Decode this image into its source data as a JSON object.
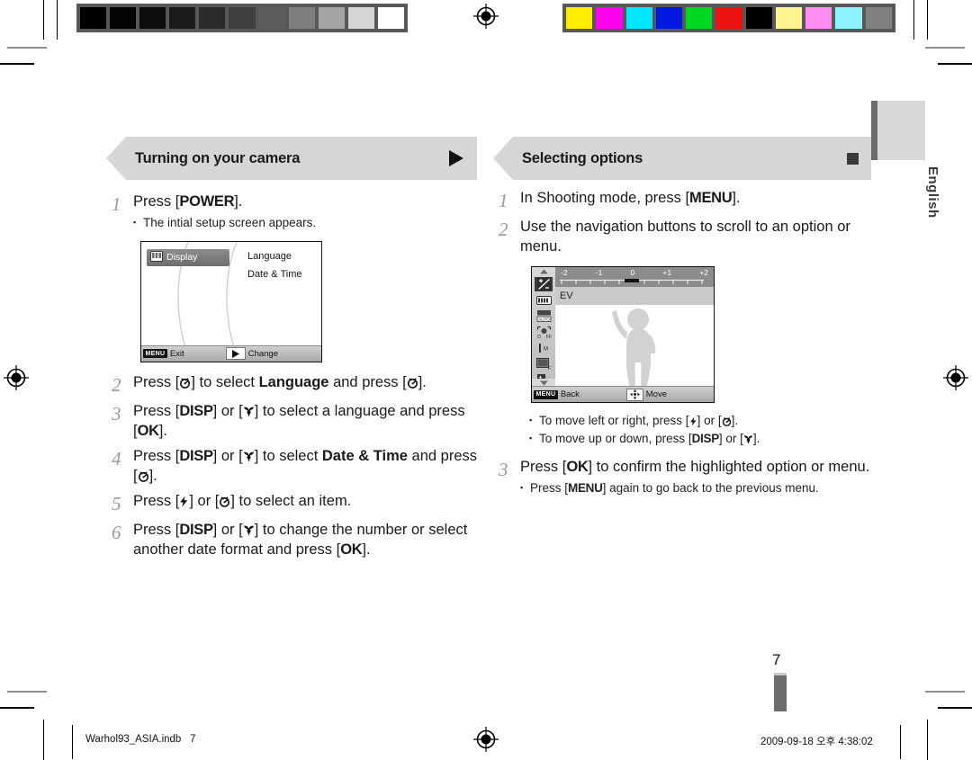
{
  "document": {
    "language_tab": "English",
    "page_number": "7",
    "footer": {
      "file_name": "Warhol93_ASIA.indb",
      "file_page": "7",
      "timestamp": "2009-09-18   오후 4:38:02"
    }
  },
  "calibration": {
    "grayscale_swatches": [
      "#000000",
      "#050505",
      "#0d0d0d",
      "#1b1b1b",
      "#2b2b2b",
      "#3f3f3f",
      "#5c5c5c",
      "#7d7d7d",
      "#a5a5a5",
      "#d5d5d5",
      "#ffffff"
    ],
    "color_swatches": [
      "#ffee00",
      "#ff00ee",
      "#00e8ff",
      "#0018e0",
      "#00d722",
      "#ee1111",
      "#000000",
      "#fff291",
      "#ff8cf2",
      "#8cf2ff",
      "#808080"
    ]
  },
  "left_column": {
    "banner": {
      "title": "Turning on your camera",
      "marker_icon": "triangle-right-icon"
    },
    "steps": [
      {
        "num": "1",
        "text_pre": "Press [",
        "key": "POWER",
        "text_post": "].",
        "bullets": [
          "The intial setup screen appears."
        ]
      }
    ],
    "lcd_setup": {
      "selected_item": "Display",
      "selected_icon": "display-icon",
      "menu_items": [
        "Language",
        "Date & Time"
      ],
      "bottom_bar": {
        "menu_badge": "MENU",
        "left_label": "Exit",
        "right_icon": "triangle-right-icon",
        "right_label": "Change"
      }
    },
    "steps_after": [
      {
        "num": "2",
        "segments": [
          {
            "t": "text",
            "v": "Press ["
          },
          {
            "t": "icon",
            "v": "timer-icon"
          },
          {
            "t": "text",
            "v": "] to select "
          },
          {
            "t": "bold",
            "v": "Language"
          },
          {
            "t": "text",
            "v": " and press ["
          },
          {
            "t": "icon",
            "v": "timer-icon"
          },
          {
            "t": "text",
            "v": "]."
          }
        ]
      },
      {
        "num": "3",
        "segments": [
          {
            "t": "text",
            "v": "Press ["
          },
          {
            "t": "key",
            "v": "DISP"
          },
          {
            "t": "text",
            "v": "] or ["
          },
          {
            "t": "icon",
            "v": "macro-icon"
          },
          {
            "t": "text",
            "v": "] to select a language and press ["
          },
          {
            "t": "key",
            "v": "OK"
          },
          {
            "t": "text",
            "v": "]."
          }
        ]
      },
      {
        "num": "4",
        "segments": [
          {
            "t": "text",
            "v": "Press ["
          },
          {
            "t": "key",
            "v": "DISP"
          },
          {
            "t": "text",
            "v": "] or ["
          },
          {
            "t": "icon",
            "v": "macro-icon"
          },
          {
            "t": "text",
            "v": "] to select "
          },
          {
            "t": "bold",
            "v": "Date & Time"
          },
          {
            "t": "text",
            "v": " and press ["
          },
          {
            "t": "icon",
            "v": "timer-icon"
          },
          {
            "t": "text",
            "v": "]."
          }
        ]
      },
      {
        "num": "5",
        "segments": [
          {
            "t": "text",
            "v": "Press ["
          },
          {
            "t": "icon",
            "v": "flash-icon"
          },
          {
            "t": "text",
            "v": "] or ["
          },
          {
            "t": "icon",
            "v": "timer-icon"
          },
          {
            "t": "text",
            "v": "] to select an item."
          }
        ]
      },
      {
        "num": "6",
        "segments": [
          {
            "t": "text",
            "v": "Press ["
          },
          {
            "t": "key",
            "v": "DISP"
          },
          {
            "t": "text",
            "v": "] or ["
          },
          {
            "t": "icon",
            "v": "macro-icon"
          },
          {
            "t": "text",
            "v": "] to change the number or select another date format and press ["
          },
          {
            "t": "key",
            "v": "OK"
          },
          {
            "t": "text",
            "v": "]."
          }
        ]
      }
    ]
  },
  "right_column": {
    "banner": {
      "title": "Selecting options",
      "marker_icon": "square-icon"
    },
    "steps": [
      {
        "num": "1",
        "segments": [
          {
            "t": "text",
            "v": "In Shooting mode, press ["
          },
          {
            "t": "key",
            "v": "MENU"
          },
          {
            "t": "text",
            "v": "]."
          }
        ]
      },
      {
        "num": "2",
        "segments": [
          {
            "t": "text",
            "v": "Use the navigation buttons to scroll to an option or menu."
          }
        ]
      }
    ],
    "lcd_menu": {
      "ev_scale": {
        "labels": [
          "-2",
          "-1",
          "0",
          "+1",
          "+2"
        ],
        "current": "0"
      },
      "option_label": "EV",
      "sidebar_icons": [
        "ev-exposure-icon",
        "white-balance-icon",
        "iso-auto-icon",
        "face-detect-off-icon",
        "focus-area-icon",
        "image-quality-icon",
        "flash-off-icon"
      ],
      "scroll_up_icon": "chevron-up-icon",
      "scroll_down_icon": "chevron-down-icon",
      "bottom_bar": {
        "menu_badge": "MENU",
        "left_label": "Back",
        "right_icon": "four-way-nav-icon",
        "right_label": "Move"
      }
    },
    "bullets_after_2": [
      {
        "segments": [
          {
            "t": "text",
            "v": "To move left or right, press ["
          },
          {
            "t": "icon",
            "v": "flash-icon"
          },
          {
            "t": "text",
            "v": "] or ["
          },
          {
            "t": "icon",
            "v": "timer-icon"
          },
          {
            "t": "text",
            "v": "]."
          }
        ]
      },
      {
        "segments": [
          {
            "t": "text",
            "v": "To move up or down, press ["
          },
          {
            "t": "key",
            "v": "DISP"
          },
          {
            "t": "text",
            "v": "] or ["
          },
          {
            "t": "icon",
            "v": "macro-icon"
          },
          {
            "t": "text",
            "v": "]."
          }
        ]
      }
    ],
    "step3": {
      "num": "3",
      "segments": [
        {
          "t": "text",
          "v": "Press ["
        },
        {
          "t": "key",
          "v": "OK"
        },
        {
          "t": "text",
          "v": "] to confirm the highlighted option or menu."
        }
      ],
      "bullets": [
        {
          "segments": [
            {
              "t": "text",
              "v": "Press ["
            },
            {
              "t": "key",
              "v": "MENU"
            },
            {
              "t": "text",
              "v": "] again to go back to the previous menu."
            }
          ]
        }
      ]
    }
  }
}
